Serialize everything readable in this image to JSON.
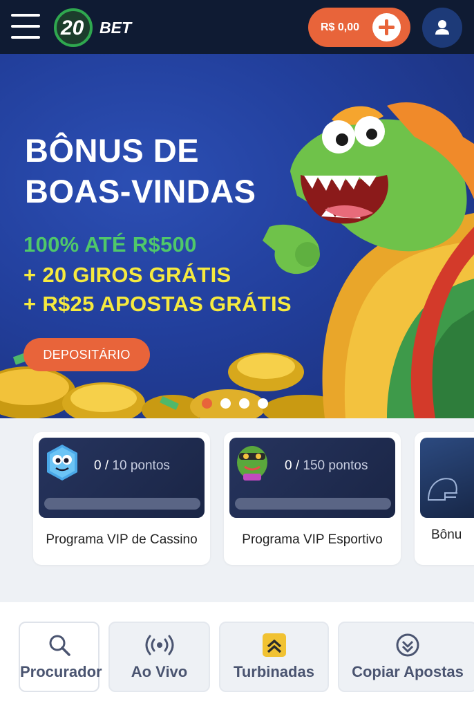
{
  "header": {
    "logo_number": "20",
    "logo_text": "BET",
    "balance": "R$ 0,00"
  },
  "banner": {
    "title_line1": "BÔNUS DE",
    "title_line2": "BOAS-VINDAS",
    "offer_line1": "100% ATÉ R$500",
    "offer_line2": "+ 20 GIROS GRÁTIS",
    "offer_line3": "+ R$25 APOSTAS GRÁTIS",
    "cta_label": "DEPOSITÁRIO",
    "slides_total": 4,
    "active_slide": 1
  },
  "vip_cards": [
    {
      "current": "0",
      "total": "10",
      "unit": "pontos",
      "label": "Programa VIP de Cassino"
    },
    {
      "current": "0",
      "total": "150",
      "unit": "pontos",
      "label": "Programa VIP Esportivo"
    },
    {
      "label": "Bônu"
    }
  ],
  "quick_links": [
    {
      "label": "Procurador",
      "icon": "search-icon"
    },
    {
      "label": "Ao Vivo",
      "icon": "live-broadcast-icon"
    },
    {
      "label": "Turbinadas",
      "icon": "boost-chevrons-icon"
    },
    {
      "label": "Copiar Apostas",
      "icon": "copy-bets-icon"
    }
  ],
  "colors": {
    "header_bg": "#0f1b33",
    "accent": "#e8643a",
    "banner_green": "#4fc86a",
    "banner_yellow": "#f6ea3e"
  }
}
